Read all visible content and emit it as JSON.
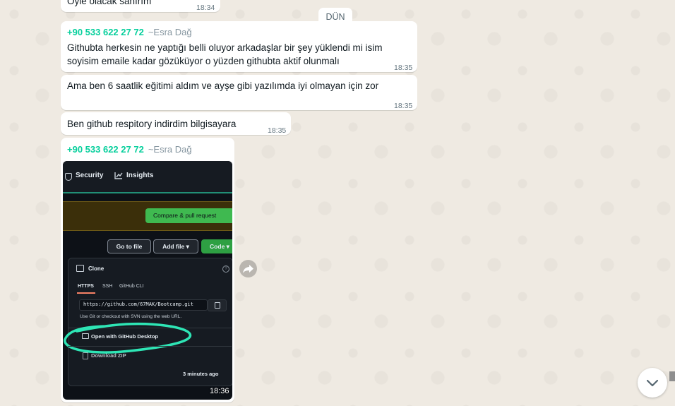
{
  "messages": [
    {
      "text": "Öyle olacak sanırım",
      "time": "18:34"
    },
    {
      "sender_phone": "+90 533 622 27 72",
      "sender_name": "~Esra Dağ",
      "line1": "Githubta herkesin ne yaptığı belli oluyor arkadaşlar bir şey yüklendi mi isim",
      "line2": "soyisim emaile kadar gözüküyor o yüzden githubta aktif olunmalı",
      "time": "18:35"
    },
    {
      "text": "Ama ben 6 saatlik eğitimi aldım ve ayşe gibi yazılımda iyi olmayan için zor",
      "time": "18:35"
    },
    {
      "text": "Ben github respitory indirdim bilgisayara",
      "time": "18:35"
    },
    {
      "sender_phone": "+90 533 622 27 72",
      "sender_name": "~Esra Dağ",
      "time": "18:36"
    }
  ],
  "day_divider": "DÜN",
  "photo": {
    "tab_security": "Security",
    "tab_insights": "Insights",
    "compare_button": "Compare & pull request",
    "go_to_file": "Go to file",
    "add_file": "Add file ▾",
    "code_button": "Code ▾",
    "clone_title": "Clone",
    "clone_tabs": [
      "HTTPS",
      "SSH",
      "GitHub CLI"
    ],
    "clone_url": "https://github.com/67MAK/Bootcamp.git",
    "svn_hint": "Use Git or checkout with SVN using the web URL.",
    "open_desktop": "Open with GitHub Desktop",
    "download_zip": "Download ZIP",
    "time_ago": "3 minutes ago"
  },
  "colors": {
    "sender": "#06cf9c",
    "accent_green": "#2ea043",
    "highlight": "#2ee5b5"
  }
}
